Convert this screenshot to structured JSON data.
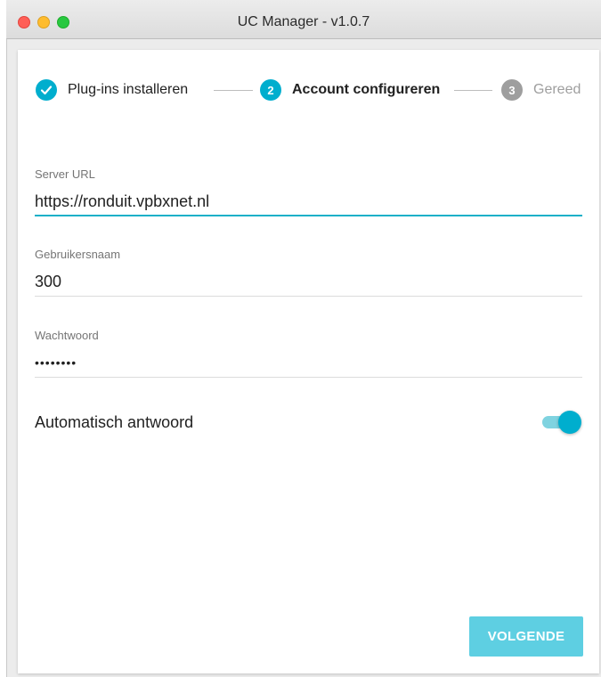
{
  "window": {
    "title": "UC Manager - v1.0.7"
  },
  "stepper": {
    "steps": [
      {
        "number": "✓",
        "label": "Plug-ins installeren",
        "state": "completed"
      },
      {
        "number": "2",
        "label": "Account configureren",
        "state": "active"
      },
      {
        "number": "3",
        "label": "Gereed",
        "state": "inactive"
      }
    ]
  },
  "form": {
    "server_url": {
      "label": "Server URL",
      "value": "https://ronduit.vpbxnet.nl"
    },
    "username": {
      "label": "Gebruikersnaam",
      "value": "300"
    },
    "password": {
      "label": "Wachtwoord",
      "value": "••••••••"
    }
  },
  "auto_answer": {
    "label": "Automatisch antwoord",
    "enabled": true
  },
  "actions": {
    "next_label": "VOLGENDE"
  },
  "colors": {
    "accent": "#00aece",
    "accent_light": "#5ecfe2",
    "inactive": "#9e9e9e",
    "close": "#ff5f57",
    "minimize": "#febc2e",
    "maximize": "#28c840"
  }
}
